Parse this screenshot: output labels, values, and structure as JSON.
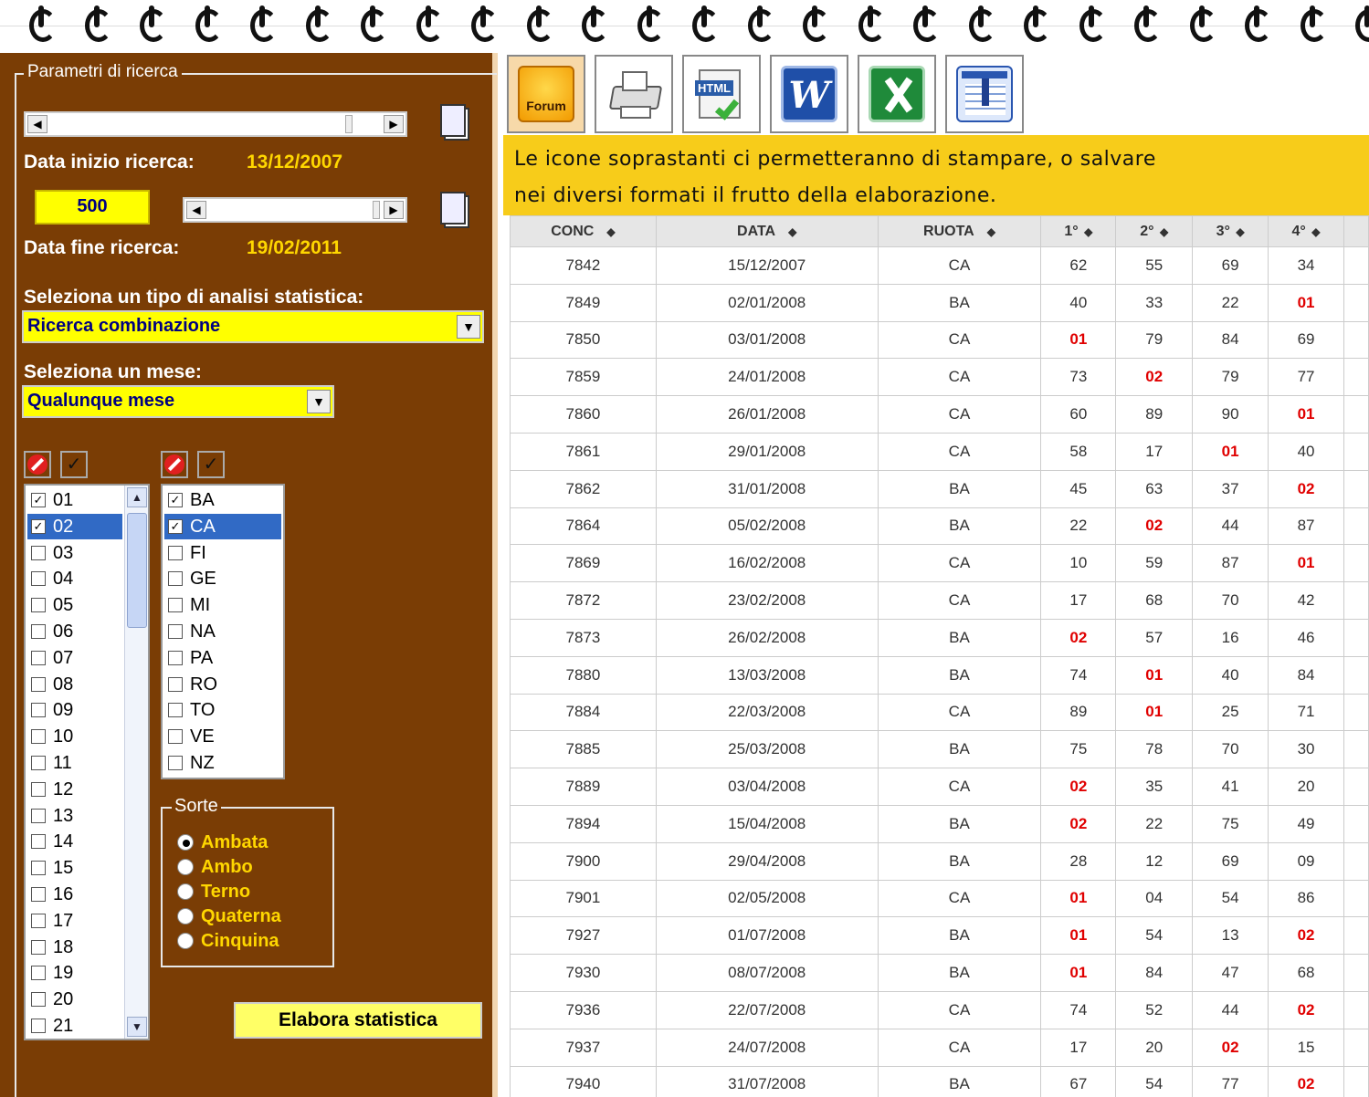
{
  "left_panel": {
    "legend": "Parametri di ricerca",
    "data_inizio_label": "Data inizio ricerca:",
    "data_inizio_value": "13/12/2007",
    "range_value": "500",
    "data_fine_label": "Data fine ricerca:",
    "data_fine_value": "19/02/2011",
    "analisi_label": "Seleziona un tipo di analisi statistica:",
    "analisi_selected": "Ricerca combinazione",
    "mese_label": "Seleziona un mese:",
    "mese_selected": "Qualunque mese",
    "numbers_list": [
      {
        "label": "01",
        "checked": true
      },
      {
        "label": "02",
        "checked": true,
        "selected": true
      },
      {
        "label": "03"
      },
      {
        "label": "04"
      },
      {
        "label": "05"
      },
      {
        "label": "06"
      },
      {
        "label": "07"
      },
      {
        "label": "08"
      },
      {
        "label": "09"
      },
      {
        "label": "10"
      },
      {
        "label": "11"
      },
      {
        "label": "12"
      },
      {
        "label": "13"
      },
      {
        "label": "14"
      },
      {
        "label": "15"
      },
      {
        "label": "16"
      },
      {
        "label": "17"
      },
      {
        "label": "18"
      },
      {
        "label": "19"
      },
      {
        "label": "20"
      },
      {
        "label": "21"
      }
    ],
    "ruote_list": [
      {
        "label": "BA",
        "checked": true
      },
      {
        "label": "CA",
        "checked": true,
        "selected": true
      },
      {
        "label": "FI"
      },
      {
        "label": "GE"
      },
      {
        "label": "MI"
      },
      {
        "label": "NA"
      },
      {
        "label": "PA"
      },
      {
        "label": "RO"
      },
      {
        "label": "TO"
      },
      {
        "label": "VE"
      },
      {
        "label": "NZ"
      }
    ],
    "sorte_legend": "Sorte",
    "sorte_options": [
      {
        "label": "Ambata",
        "selected": true
      },
      {
        "label": "Ambo"
      },
      {
        "label": "Terno"
      },
      {
        "label": "Quaterna"
      },
      {
        "label": "Cinquina"
      }
    ],
    "elabora_label": "Elabora statistica"
  },
  "toolbar": {
    "buttons": [
      "forum-icon",
      "printer-icon",
      "html-icon",
      "word-icon",
      "excel-icon",
      "table-export-icon"
    ],
    "forum_label": "Forum",
    "html_label": "HTML",
    "word_label": "W"
  },
  "banner": {
    "line1": "Le icone soprastanti ci permetteranno di stampare, o salvare",
    "line2": "nei diversi formati il frutto della elaborazione."
  },
  "table": {
    "headers": [
      "CONC",
      "DATA",
      "RUOTA",
      "1° ",
      "2° ",
      "3° ",
      "4° "
    ],
    "rows": [
      [
        "7842",
        "15/12/2007",
        "CA",
        "62",
        "55",
        "69",
        "34"
      ],
      [
        "7849",
        "02/01/2008",
        "BA",
        "40",
        "33",
        "22",
        "01"
      ],
      [
        "7850",
        "03/01/2008",
        "CA",
        "01",
        "79",
        "84",
        "69"
      ],
      [
        "7859",
        "24/01/2008",
        "CA",
        "73",
        "02",
        "79",
        "77"
      ],
      [
        "7860",
        "26/01/2008",
        "CA",
        "60",
        "89",
        "90",
        "01"
      ],
      [
        "7861",
        "29/01/2008",
        "CA",
        "58",
        "17",
        "01",
        "40"
      ],
      [
        "7862",
        "31/01/2008",
        "BA",
        "45",
        "63",
        "37",
        "02"
      ],
      [
        "7864",
        "05/02/2008",
        "BA",
        "22",
        "02",
        "44",
        "87"
      ],
      [
        "7869",
        "16/02/2008",
        "CA",
        "10",
        "59",
        "87",
        "01"
      ],
      [
        "7872",
        "23/02/2008",
        "CA",
        "17",
        "68",
        "70",
        "42"
      ],
      [
        "7873",
        "26/02/2008",
        "BA",
        "02",
        "57",
        "16",
        "46"
      ],
      [
        "7880",
        "13/03/2008",
        "BA",
        "74",
        "01",
        "40",
        "84"
      ],
      [
        "7884",
        "22/03/2008",
        "CA",
        "89",
        "01",
        "25",
        "71"
      ],
      [
        "7885",
        "25/03/2008",
        "BA",
        "75",
        "78",
        "70",
        "30"
      ],
      [
        "7889",
        "03/04/2008",
        "CA",
        "02",
        "35",
        "41",
        "20"
      ],
      [
        "7894",
        "15/04/2008",
        "BA",
        "02",
        "22",
        "75",
        "49"
      ],
      [
        "7900",
        "29/04/2008",
        "BA",
        "28",
        "12",
        "69",
        "09"
      ],
      [
        "7901",
        "02/05/2008",
        "CA",
        "01",
        "04",
        "54",
        "86"
      ],
      [
        "7927",
        "01/07/2008",
        "BA",
        "01",
        "54",
        "13",
        "02"
      ],
      [
        "7930",
        "08/07/2008",
        "BA",
        "01",
        "84",
        "47",
        "68"
      ],
      [
        "7936",
        "22/07/2008",
        "CA",
        "74",
        "52",
        "44",
        "02"
      ],
      [
        "7937",
        "24/07/2008",
        "CA",
        "17",
        "20",
        "02",
        "15"
      ],
      [
        "7940",
        "31/07/2008",
        "BA",
        "67",
        "54",
        "77",
        "02"
      ]
    ],
    "highlight_values": [
      "01",
      "02"
    ]
  },
  "colors": {
    "panel_bg": "#7a3d05",
    "accent_yellow": "#ffff00",
    "banner_bg": "#f7cc1a",
    "highlight_red": "#e00000"
  }
}
